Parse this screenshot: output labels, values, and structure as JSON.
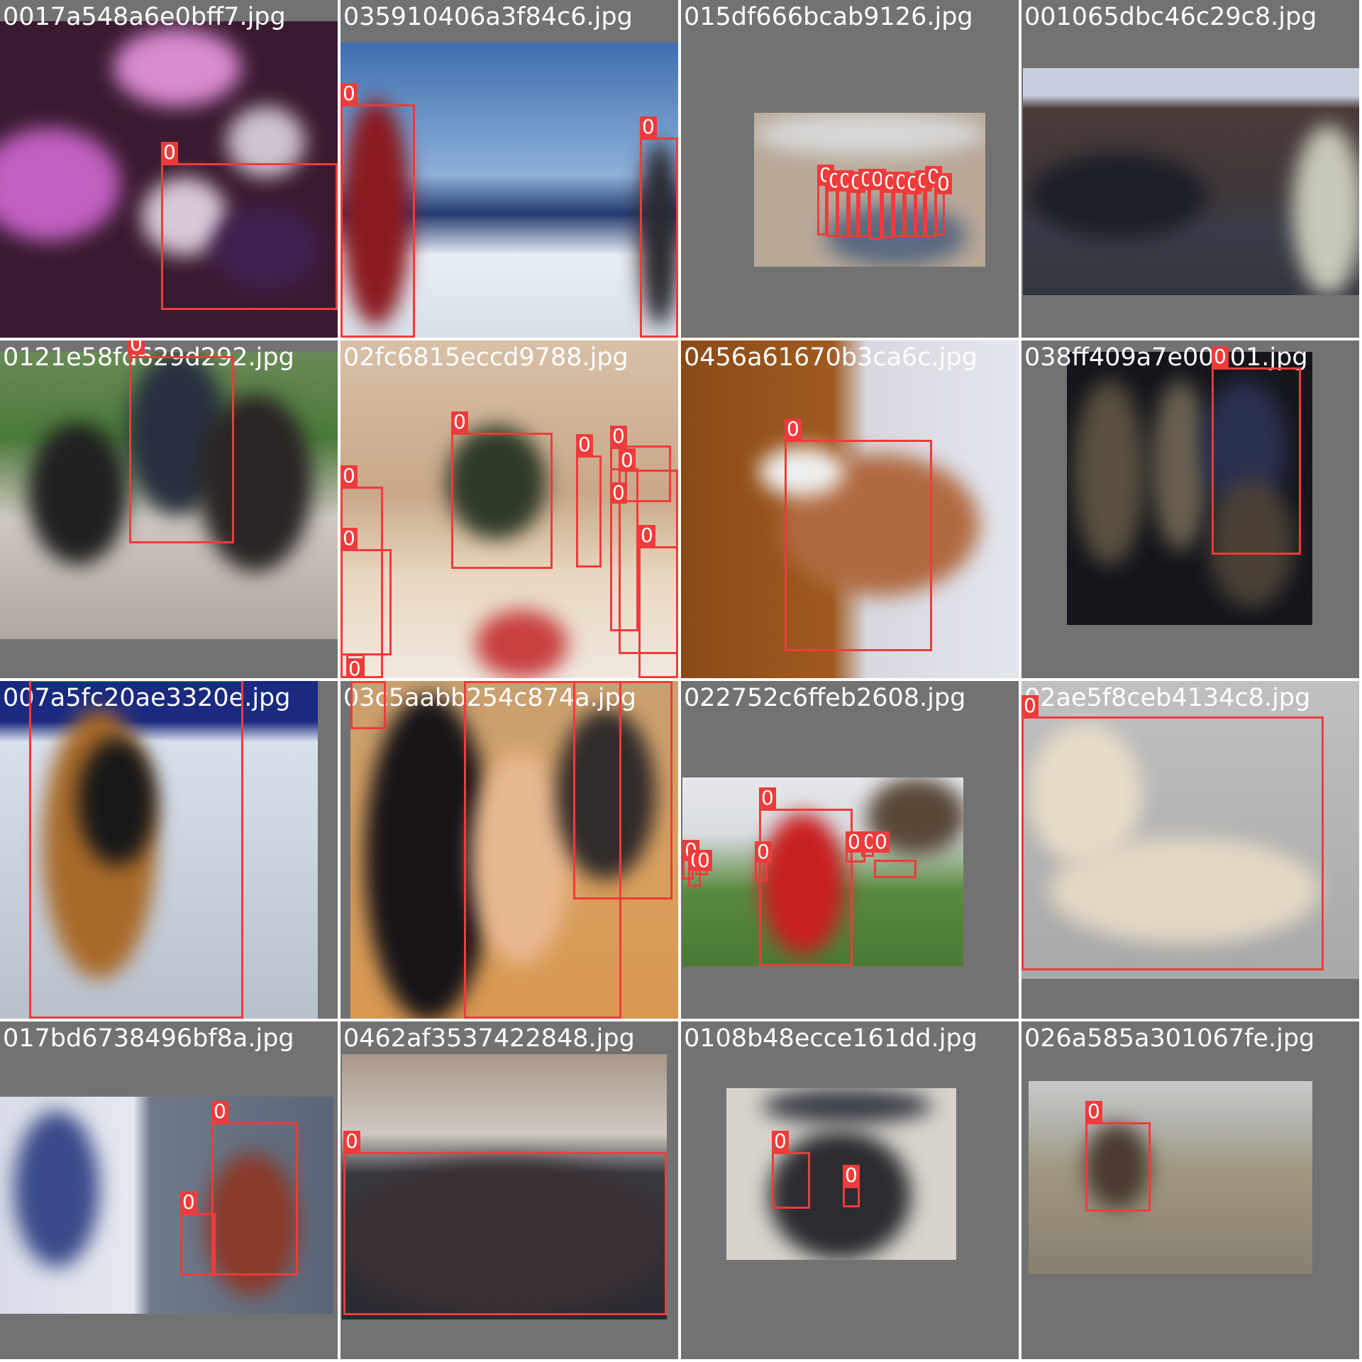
{
  "tiles": [
    {
      "filename": "0017a548a6e0bff7.jpg",
      "box_label": "0",
      "box_count": 1
    },
    {
      "filename": "035910406a3f84c6.jpg",
      "box_label": "0",
      "box_count": 2
    },
    {
      "filename": "015df666bcab9126.jpg",
      "box_label": "0",
      "box_count": 12
    },
    {
      "filename": "001065dbc46c29c8.jpg",
      "box_label": "0",
      "box_count": 0
    },
    {
      "filename": "0121e58fd629d292.jpg",
      "box_label": "0",
      "box_count": 1
    },
    {
      "filename": "02fc6815eccd9788.jpg",
      "box_label": "0",
      "box_count": 10
    },
    {
      "filename": "0456a61670b3ca6c.jpg",
      "box_label": "0",
      "box_count": 1
    },
    {
      "filename": "038ff409a7e00801.jpg",
      "box_label": "0",
      "box_count": 1
    },
    {
      "filename": "007a5fc20ae3320e.jpg",
      "box_label": "0",
      "box_count": 1
    },
    {
      "filename": "03c5aabb254c874a.jpg",
      "box_label": "0",
      "box_count": 3
    },
    {
      "filename": "022752c6ffeb2608.jpg",
      "box_label": "0",
      "box_count": 8
    },
    {
      "filename": "02ae5f8ceb4134c8.jpg",
      "box_label": "0",
      "box_count": 1
    },
    {
      "filename": "017bd6738496bf8a.jpg",
      "box_label": "0",
      "box_count": 2
    },
    {
      "filename": "0462af3537422848.jpg",
      "box_label": "0",
      "box_count": 1
    },
    {
      "filename": "0108b48ecce161dd.jpg",
      "box_label": "0",
      "box_count": 2
    },
    {
      "filename": "026a585a301067fe.jpg",
      "box_label": "0",
      "box_count": 1
    }
  ]
}
